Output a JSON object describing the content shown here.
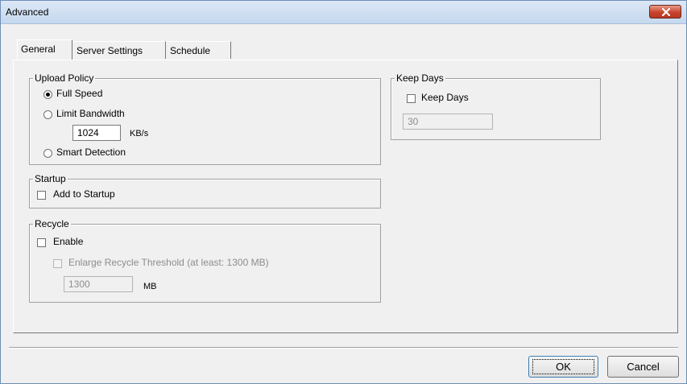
{
  "window": {
    "title": "Advanced"
  },
  "tabs": [
    {
      "label": "General",
      "selected": true
    },
    {
      "label": "Server Settings",
      "selected": false
    },
    {
      "label": "Schedule",
      "selected": false
    }
  ],
  "upload_policy": {
    "legend": "Upload Policy",
    "options": [
      {
        "label": "Full Speed",
        "checked": true
      },
      {
        "label": "Limit Bandwidth",
        "checked": false
      },
      {
        "label": "Smart Detection",
        "checked": false
      }
    ],
    "bandwidth_value": "1024",
    "bandwidth_unit": "KB/s"
  },
  "startup": {
    "legend": "Startup",
    "add_to_startup": {
      "label": "Add to Startup",
      "checked": false
    }
  },
  "recycle": {
    "legend": "Recycle",
    "enable": {
      "label": "Enable",
      "checked": false
    },
    "enlarge": {
      "label": "Enlarge Recycle Threshold (at least: 1300 MB)",
      "checked": false,
      "disabled": true
    },
    "threshold_value": "1300",
    "threshold_unit": "MB"
  },
  "keep_days": {
    "legend": "Keep Days",
    "checkbox": {
      "label": "Keep Days",
      "checked": false
    },
    "value": "30"
  },
  "buttons": {
    "ok": "OK",
    "cancel": "Cancel"
  },
  "icons": {
    "close": "close-icon"
  },
  "colors": {
    "close_button": "#c7452c",
    "title_bar": "#dce8f6"
  }
}
